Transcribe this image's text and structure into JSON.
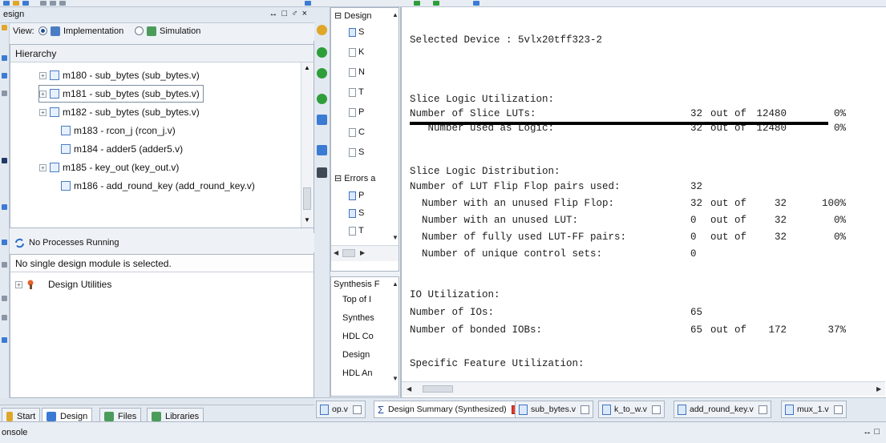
{
  "left_panel": {
    "title": "esign",
    "controls": "↔ □ ♂ ×",
    "view_label": "View:",
    "view_options": [
      "Implementation",
      "Simulation"
    ],
    "hierarchy_title": "Hierarchy",
    "tree": [
      {
        "label": "m180 - sub_bytes (sub_bytes.v)",
        "expander": "+"
      },
      {
        "label": "m181 - sub_bytes (sub_bytes.v)",
        "expander": "+"
      },
      {
        "label": "m182 - sub_bytes (sub_bytes.v)",
        "expander": "+"
      },
      {
        "label": "m183 - rcon_j (rcon_j.v)",
        "expander": ""
      },
      {
        "label": "m184 - adder5 (adder5.v)",
        "expander": ""
      },
      {
        "label": "m185 - key_out (key_out.v)",
        "expander": "+"
      },
      {
        "label": "m186 - add_round_key (add_round_key.v)",
        "expander": ""
      }
    ],
    "processes_status": "No Processes Running",
    "module_message": "No single design module is selected.",
    "design_utilities": "Design Utilities",
    "tabs": [
      "Start",
      "Design",
      "Files",
      "Libraries"
    ]
  },
  "mid_panel": {
    "top_title": "Design",
    "top_items": [
      "S",
      "K",
      "N",
      "T",
      "P",
      "C",
      "S"
    ],
    "errors_label": "Errors a",
    "error_items": [
      "P",
      "S",
      "T"
    ],
    "bottom_title": "Synthesis F",
    "bottom_items": [
      "Top of I",
      "Synthes",
      "HDL Co",
      "Design",
      "HDL An"
    ]
  },
  "summary": {
    "selected_device": "Selected Device : 5vlx20tff323-2",
    "section1": "Slice Logic Utilization:",
    "rows1": [
      {
        "label": "Number of Slice LUTs:",
        "value": "32",
        "of": "out of",
        "total": "12480",
        "pct": "0%"
      },
      {
        "label": "   Number used as Logic:",
        "value": "32",
        "of": "out of",
        "total": "12480",
        "pct": "0%"
      }
    ],
    "section2": "Slice Logic Distribution:",
    "rows2": [
      {
        "label": "Number of LUT Flip Flop pairs used:",
        "value": "32",
        "of": "",
        "total": "",
        "pct": ""
      },
      {
        "label": "  Number with an unused Flip Flop:",
        "value": "32",
        "of": "out of",
        "total": "32",
        "pct": "100%"
      },
      {
        "label": "  Number with an unused LUT:",
        "value": "0",
        "of": "out of",
        "total": "32",
        "pct": "0%"
      },
      {
        "label": "  Number of fully used LUT-FF pairs:",
        "value": "0",
        "of": "out of",
        "total": "32",
        "pct": "0%"
      },
      {
        "label": "  Number of unique control sets:",
        "value": "0",
        "of": "",
        "total": "",
        "pct": ""
      }
    ],
    "section3": "IO Utilization:",
    "rows3": [
      {
        "label": "Number of IOs:",
        "value": "65",
        "of": "",
        "total": "",
        "pct": ""
      },
      {
        "label": "Number of bonded IOBs:",
        "value": "65",
        "of": "out of",
        "total": "172",
        "pct": "37%"
      }
    ],
    "section4": "Specific Feature Utilization:"
  },
  "editor_tabs": [
    "op.v",
    "Design Summary (Synthesized)",
    "sub_bytes.v",
    "k_to_w.v",
    "add_round_key.v",
    "mux_1.v"
  ],
  "console_label": "onsole",
  "console_controls": "↔ □",
  "colors": {
    "accent": "#1f4f9c",
    "close_red": "#e23d2d",
    "green": "#2e9e3a"
  }
}
